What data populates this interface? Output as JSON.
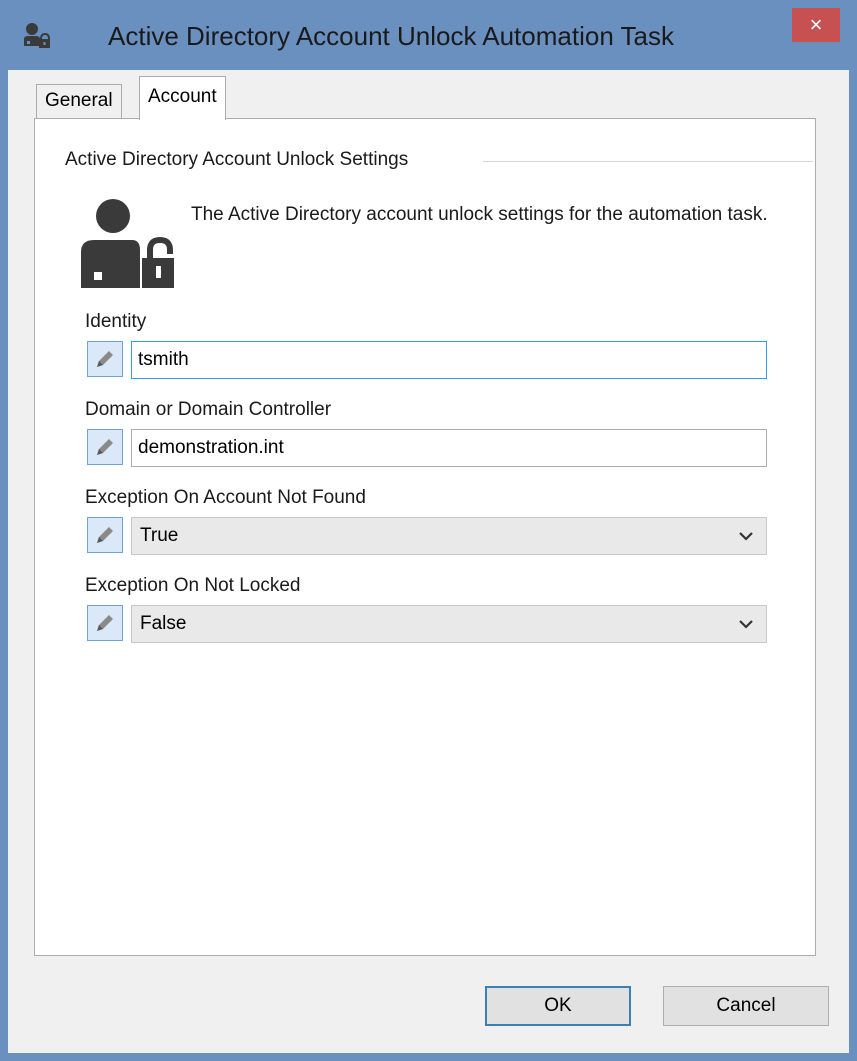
{
  "window": {
    "title": "Active Directory Account Unlock Automation Task",
    "close_glyph": "×",
    "close_color": "#c75050",
    "frame_color": "#6a90bf"
  },
  "tabs": [
    {
      "label": "General",
      "selected": false
    },
    {
      "label": "Account",
      "selected": true
    }
  ],
  "settings": {
    "group_title": "Active Directory Account Unlock Settings",
    "description": "The Active Directory account unlock settings for the automation task.",
    "icon": "user-unlock-icon"
  },
  "fields": {
    "identity": {
      "label": "Identity",
      "value": "tsmith"
    },
    "domain": {
      "label": "Domain or Domain Controller",
      "value": "demonstration.int"
    },
    "exception_not_found": {
      "label": "Exception On Account Not Found",
      "value": "True"
    },
    "exception_not_locked": {
      "label": "Exception On Not Locked",
      "value": "False"
    }
  },
  "buttons": {
    "ok": "OK",
    "cancel": "Cancel"
  },
  "icons": {
    "edit": "pencil-icon",
    "dropdown": "chevron-down-icon",
    "title": "user-lock-icon"
  }
}
